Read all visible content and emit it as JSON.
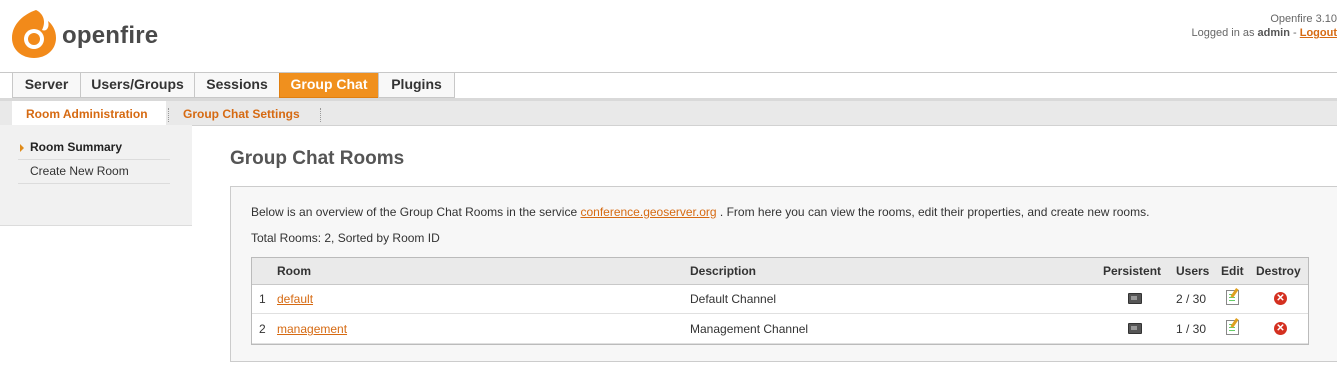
{
  "header": {
    "logo_text": "openfire",
    "version": "Openfire 3.10",
    "logged_in_prefix": "Logged in as ",
    "user": "admin",
    "separator": " - ",
    "logout": "Logout"
  },
  "tabs": [
    {
      "label": "Server",
      "active": false
    },
    {
      "label": "Users/Groups",
      "active": false
    },
    {
      "label": "Sessions",
      "active": false
    },
    {
      "label": "Group Chat",
      "active": true
    },
    {
      "label": "Plugins",
      "active": false
    }
  ],
  "subtabs": [
    {
      "label": "Room Administration",
      "active": true
    },
    {
      "label": "Group Chat Settings",
      "active": false
    }
  ],
  "sidebar": {
    "items": [
      {
        "label": "Room Summary",
        "active": true
      },
      {
        "label": "Create New Room",
        "active": false
      }
    ]
  },
  "main": {
    "title": "Group Chat Rooms",
    "intro_before": "Below is an overview of the Group Chat Rooms in the service ",
    "service_link": "conference.geoserver.org",
    "intro_after": " . From here you can view the rooms, edit their properties, and create new rooms.",
    "total": "Total Rooms: 2, Sorted by Room ID",
    "table": {
      "headers": [
        "Room",
        "Description",
        "Persistent",
        "Users",
        "Edit",
        "Destroy"
      ],
      "rows": [
        {
          "num": "1",
          "room": "default",
          "description": "Default Channel",
          "users": "2 / 30"
        },
        {
          "num": "2",
          "room": "management",
          "description": "Management Channel",
          "users": "1 / 30"
        }
      ]
    }
  },
  "colors": {
    "accent": "#f0901e",
    "link": "#d66a12"
  }
}
